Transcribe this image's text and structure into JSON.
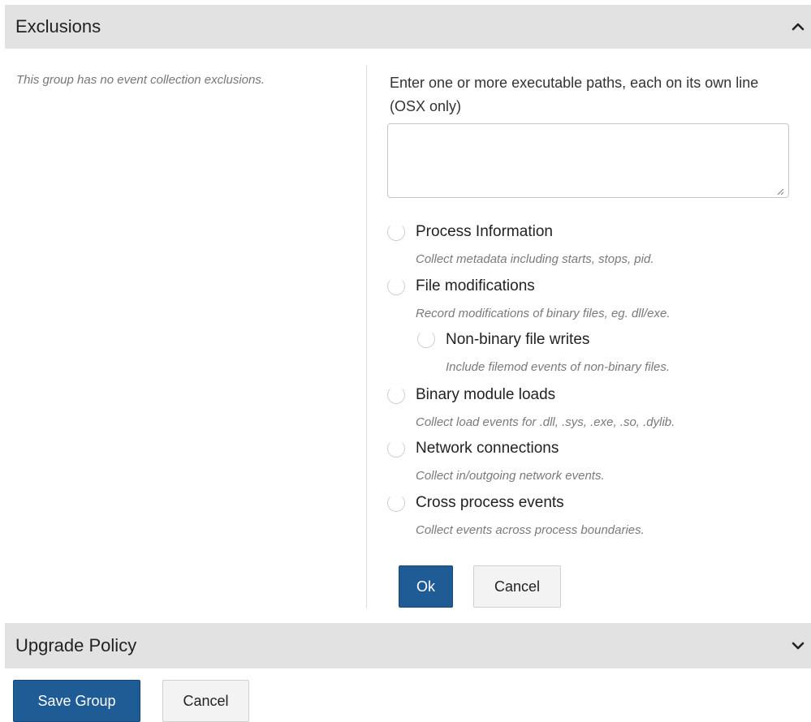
{
  "exclusions": {
    "title": "Exclusions",
    "expanded_icon": "chevron-up-icon",
    "no_exclusions_text": "This group has no event collection exclusions.",
    "paths_label": "Enter one or more executable paths, each on its own line (OSX only)",
    "paths_value": "",
    "options": [
      {
        "label": "Process Information",
        "desc": "Collect metadata including starts, stops, pid.",
        "checked": false
      },
      {
        "label": "File modifications",
        "desc": "Record modifications of binary files, eg. dll/exe.",
        "checked": false
      },
      {
        "label": "Non-binary file writes",
        "desc": "Include filemod events of non-binary files.",
        "checked": false
      },
      {
        "label": "Binary module loads",
        "desc": "Collect load events for .dll, .sys, .exe, .so, .dylib.",
        "checked": false
      },
      {
        "label": "Network connections",
        "desc": "Collect in/outgoing network events.",
        "checked": false
      },
      {
        "label": "Cross process events",
        "desc": "Collect events across process boundaries.",
        "checked": false
      }
    ],
    "ok_label": "Ok",
    "cancel_label": "Cancel"
  },
  "upgrade_policy": {
    "title": "Upgrade Policy",
    "collapsed_icon": "chevron-down-icon"
  },
  "footer": {
    "save_label": "Save Group",
    "cancel_label": "Cancel"
  },
  "colors": {
    "header_bg": "#e2e2e2",
    "primary": "#1f5c96"
  }
}
